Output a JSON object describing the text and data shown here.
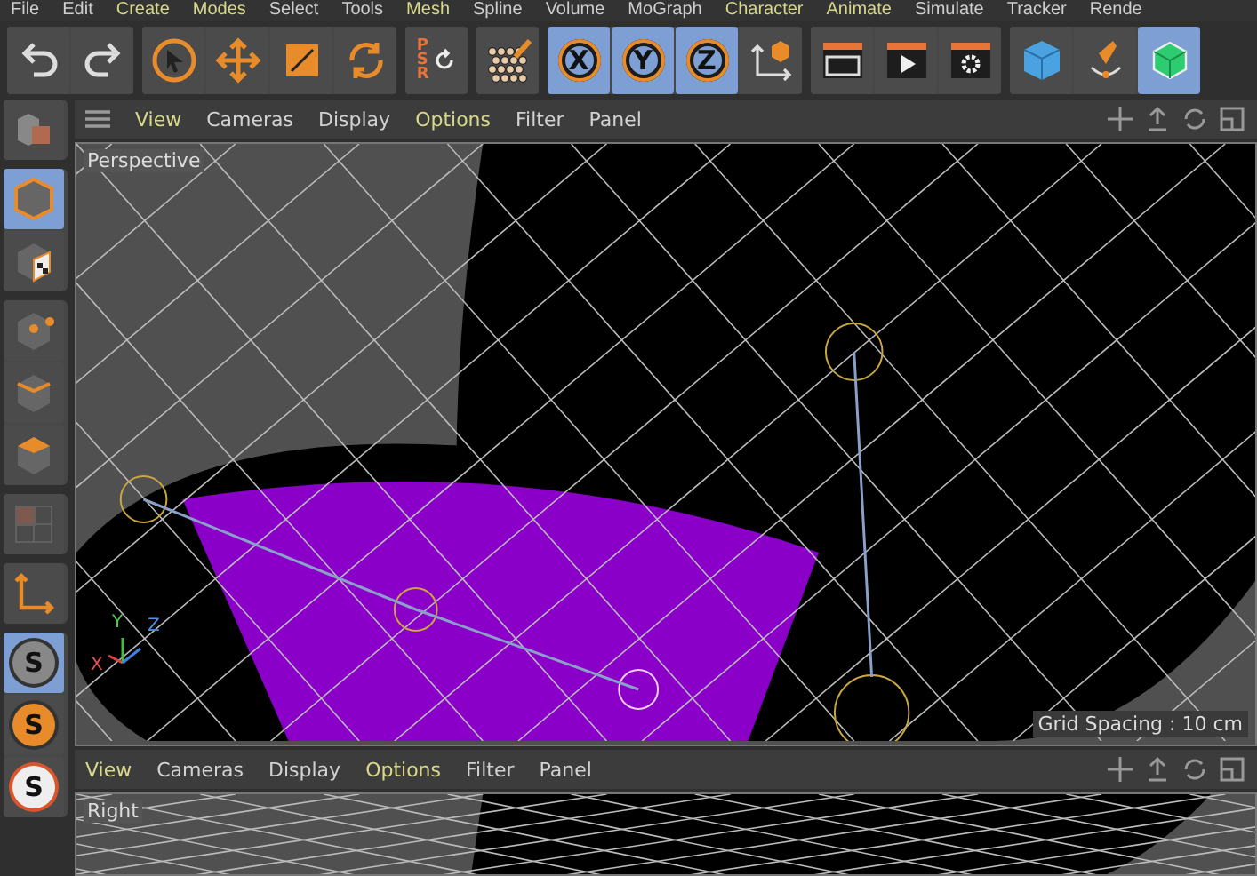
{
  "menu": [
    {
      "label": "File",
      "highlighted": false
    },
    {
      "label": "Edit",
      "highlighted": false
    },
    {
      "label": "Create",
      "highlighted": true
    },
    {
      "label": "Modes",
      "highlighted": true
    },
    {
      "label": "Select",
      "highlighted": false
    },
    {
      "label": "Tools",
      "highlighted": false
    },
    {
      "label": "Mesh",
      "highlighted": true
    },
    {
      "label": "Spline",
      "highlighted": false
    },
    {
      "label": "Volume",
      "highlighted": false
    },
    {
      "label": "MoGraph",
      "highlighted": false
    },
    {
      "label": "Character",
      "highlighted": true
    },
    {
      "label": "Animate",
      "highlighted": true
    },
    {
      "label": "Simulate",
      "highlighted": false
    },
    {
      "label": "Tracker",
      "highlighted": false
    },
    {
      "label": "Rende",
      "highlighted": false
    }
  ],
  "toolbar": [
    {
      "buttons": [
        {
          "kind": "undo",
          "selected": false
        },
        {
          "kind": "redo",
          "selected": false
        }
      ]
    },
    {
      "buttons": [
        {
          "kind": "select",
          "selected": false
        },
        {
          "kind": "move",
          "selected": false
        },
        {
          "kind": "scale",
          "selected": false
        },
        {
          "kind": "rotate",
          "selected": false
        }
      ]
    },
    {
      "buttons": [
        {
          "kind": "psr",
          "label": "PSR",
          "selected": false
        }
      ]
    },
    {
      "buttons": [
        {
          "kind": "paint",
          "selected": false
        }
      ]
    },
    {
      "buttons": [
        {
          "kind": "axis-letter",
          "label": "X",
          "selected": true
        },
        {
          "kind": "axis-letter",
          "label": "Y",
          "selected": true
        },
        {
          "kind": "axis-letter",
          "label": "Z",
          "selected": true
        },
        {
          "kind": "coordinates",
          "selected": false
        }
      ]
    },
    {
      "buttons": [
        {
          "kind": "render-view",
          "selected": false
        },
        {
          "kind": "render",
          "selected": false
        },
        {
          "kind": "render-settings",
          "selected": false
        }
      ]
    },
    {
      "buttons": [
        {
          "kind": "cube",
          "selected": false
        },
        {
          "kind": "pen",
          "selected": false
        },
        {
          "kind": "green-cube",
          "selected": true
        }
      ]
    }
  ],
  "side_toolbar": [
    {
      "buttons": [
        {
          "kind": "model",
          "selected": false
        }
      ]
    },
    {
      "buttons": [
        {
          "kind": "object",
          "selected": true
        },
        {
          "kind": "texture",
          "selected": false
        }
      ]
    },
    {
      "buttons": [
        {
          "kind": "points",
          "selected": false
        },
        {
          "kind": "edges",
          "selected": false
        },
        {
          "kind": "polygons",
          "selected": false
        }
      ]
    },
    {
      "buttons": [
        {
          "kind": "uv",
          "selected": false
        }
      ]
    },
    {
      "buttons": [
        {
          "kind": "axis",
          "selected": false
        }
      ]
    },
    {
      "buttons": [
        {
          "kind": "snap",
          "label": "S",
          "selected": true
        },
        {
          "kind": "snap-orange",
          "label": "S",
          "selected": false
        },
        {
          "kind": "snap-ring",
          "label": "S",
          "selected": false
        }
      ]
    }
  ],
  "viewports": [
    {
      "menu": [
        {
          "label": "View",
          "highlighted": true
        },
        {
          "label": "Cameras",
          "highlighted": false
        },
        {
          "label": "Display",
          "highlighted": false
        },
        {
          "label": "Options",
          "highlighted": true
        },
        {
          "label": "Filter",
          "highlighted": false
        },
        {
          "label": "Panel",
          "highlighted": false
        }
      ],
      "name": "Perspective",
      "axes": [
        "X",
        "Y",
        "Z"
      ],
      "grid_spacing": "Grid Spacing : 10 cm"
    },
    {
      "menu": [
        {
          "label": "View",
          "highlighted": true
        },
        {
          "label": "Cameras",
          "highlighted": false
        },
        {
          "label": "Display",
          "highlighted": false
        },
        {
          "label": "Options",
          "highlighted": true
        },
        {
          "label": "Filter",
          "highlighted": false
        },
        {
          "label": "Panel",
          "highlighted": false
        }
      ],
      "name": "Right"
    }
  ]
}
